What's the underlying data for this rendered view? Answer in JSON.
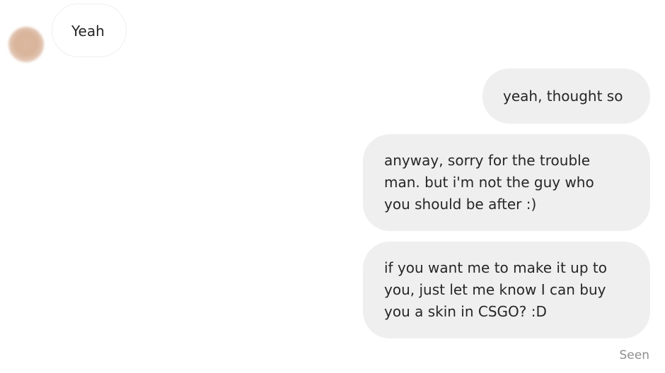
{
  "messages": [
    {
      "direction": "incoming",
      "lines": [
        "Yeah"
      ]
    },
    {
      "direction": "outgoing",
      "lines": [
        "yeah, thought so"
      ]
    },
    {
      "direction": "outgoing",
      "lines": [
        "anyway, sorry for the trouble",
        "man. but i'm not the guy who",
        "you should be after :)"
      ]
    },
    {
      "direction": "outgoing",
      "lines": [
        "if you want me to make it up to",
        "you, just let me know I can buy",
        "you a skin in CSGO? :D"
      ]
    }
  ],
  "status": {
    "seen_label": "Seen"
  },
  "colors": {
    "outgoing_bubble": "#efefef",
    "incoming_bubble": "#ffffff",
    "text": "#262626",
    "seen_text": "#8e8e8e"
  }
}
